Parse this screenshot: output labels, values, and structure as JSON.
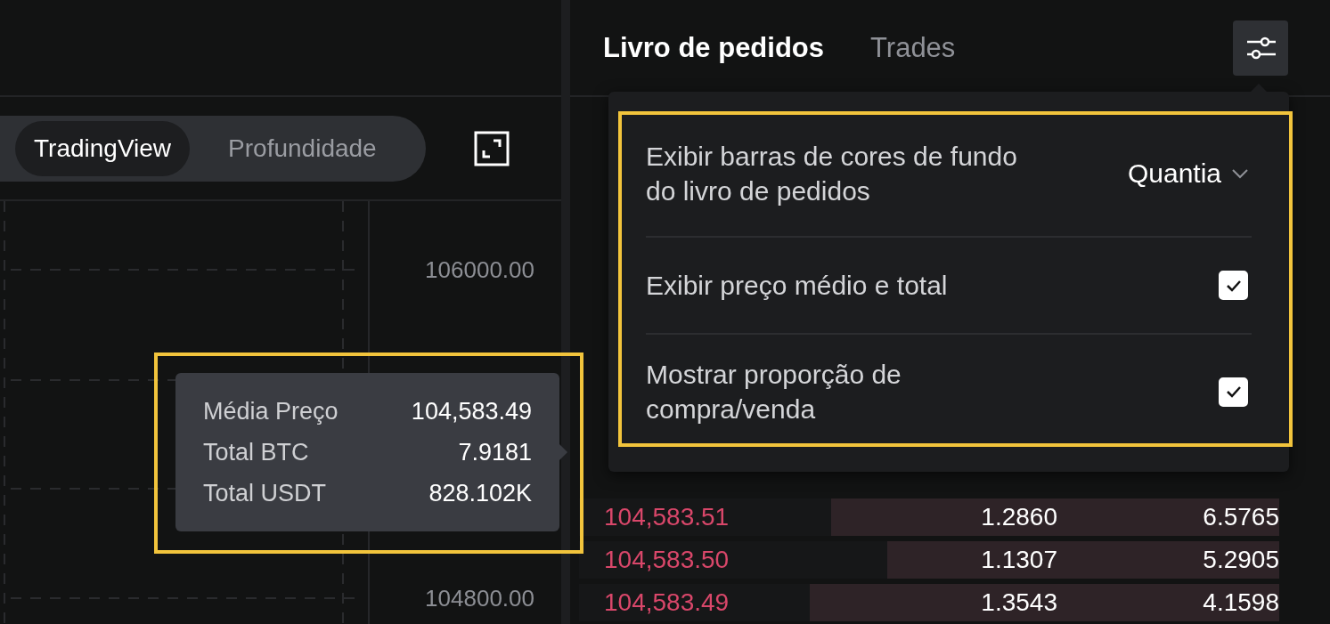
{
  "order_panel": {
    "tabs": [
      {
        "label": "Livro de pedidos",
        "selected": true
      },
      {
        "label": "Trades",
        "selected": false
      }
    ]
  },
  "chart": {
    "view_toggle": [
      {
        "label": "TradingView",
        "selected": true
      },
      {
        "label": "Profundidade",
        "selected": false
      }
    ],
    "price_axis": [
      "106000.00",
      "104800.00"
    ],
    "tooltip": {
      "rows": [
        {
          "label": "Média Preço",
          "value": "104,583.49"
        },
        {
          "label": "Total BTC",
          "value": "7.9181"
        },
        {
          "label": "Total USDT",
          "value": "828.102K"
        }
      ]
    }
  },
  "settings_menu": {
    "items": [
      {
        "kind": "dropdown",
        "label": "Exibir barras de cores de fundo do livro de pedidos",
        "value": "Quantia"
      },
      {
        "kind": "checkbox",
        "label": "Exibir preço médio e total",
        "checked": true
      },
      {
        "kind": "checkbox",
        "label": "Mostrar proporção de compra/venda",
        "checked": true
      }
    ]
  },
  "order_book": {
    "asks": [
      {
        "price": "104,583.51",
        "amount": "1.2860",
        "total": "6.5765",
        "level": 0.64
      },
      {
        "price": "104,583.50",
        "amount": "1.1307",
        "total": "5.2905",
        "level": 0.56
      },
      {
        "price": "104,583.49",
        "amount": "1.3543",
        "total": "4.1598",
        "level": 0.67
      }
    ]
  }
}
